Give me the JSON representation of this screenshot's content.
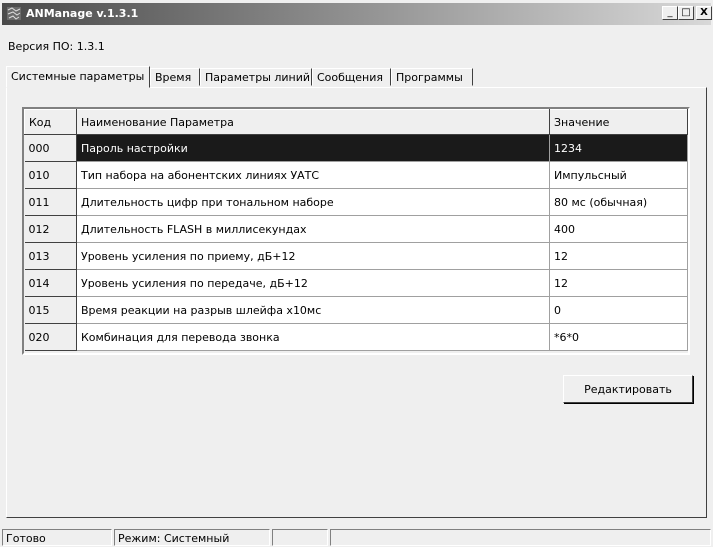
{
  "window": {
    "title": "ANManage v.1.3.1",
    "minimize": "_",
    "maximize": "□",
    "close": "X"
  },
  "version_label": "Версия ПО: 1.3.1",
  "tabs": [
    {
      "label": "Системные параметры",
      "active": true
    },
    {
      "label": "Время"
    },
    {
      "label": "Параметры линий"
    },
    {
      "label": "Сообщения"
    },
    {
      "label": "Программы"
    }
  ],
  "table": {
    "headers": [
      "Код",
      "Наименование Параметра",
      "Значение"
    ],
    "rows": [
      {
        "code": "000",
        "name": "Пароль настройки",
        "value": "1234",
        "selected": true
      },
      {
        "code": "010",
        "name": "Тип набора на абонентских линиях УАТС",
        "value": "Импульсный"
      },
      {
        "code": "011",
        "name": "Длительность цифр при тональном наборе",
        "value": "80 мс (обычная)"
      },
      {
        "code": "012",
        "name": "Длительность FLASH в миллисекундах",
        "value": "400"
      },
      {
        "code": "013",
        "name": "Уровень усиления по приему, дБ+12",
        "value": "12"
      },
      {
        "code": "014",
        "name": "Уровень усиления по передаче, дБ+12",
        "value": "12"
      },
      {
        "code": "015",
        "name": "Время реакции на разрыв шлейфа x10мс",
        "value": "0"
      },
      {
        "code": "020",
        "name": "Комбинация для перевода звонка",
        "value": "*6*0"
      }
    ]
  },
  "edit_button": "Редактировать",
  "status": {
    "state": "Готово",
    "mode": "Режим: Системный"
  }
}
